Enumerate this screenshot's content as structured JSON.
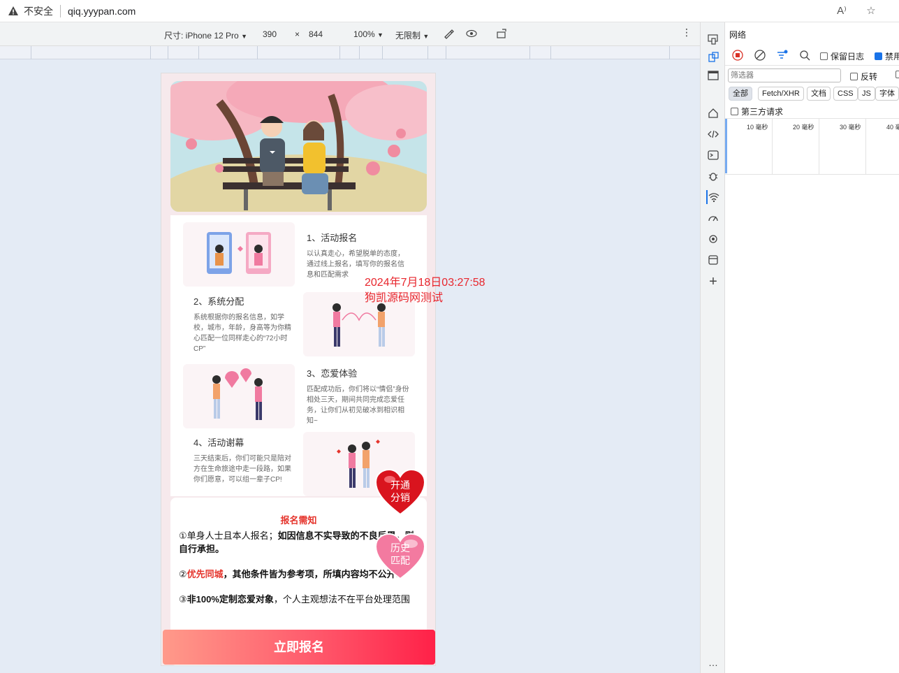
{
  "browser": {
    "security_label": "不安全",
    "url": "qiq.yyypan.com"
  },
  "device_toolbar": {
    "size_label": "尺寸: iPhone 12 Pro",
    "width": "390",
    "times": "×",
    "height": "844",
    "zoom": "100%",
    "throttle": "无限制"
  },
  "watermark": {
    "line1": "2024年7月18日03:27:58",
    "line2": "狗凯源码网测试"
  },
  "steps": [
    {
      "title": "1、活动报名",
      "desc": "以认真走心，希望脱单的态度，通过线上报名，填写你的报名信息和匹配需求"
    },
    {
      "title": "2、系统分配",
      "desc": "系统根据你的报名信息，如学校，城市，年龄，身高等为你精心匹配一位同样走心的“72小时CP”"
    },
    {
      "title": "3、恋爱体验",
      "desc": "匹配成功后，你们将以“情侣”身份相处三天，期间共同完成恋爱任务，让你们从初见破冰到相识相知~"
    },
    {
      "title": "4、活动谢幕",
      "desc": "三天结束后，你们可能只是陪对方在生命旅途中走一段路，如果你们愿意，可以组一辈子CP!"
    }
  ],
  "badges": {
    "distribution": "开通\n分销",
    "history": "历史\n匹配"
  },
  "notice": {
    "title": "报名需知",
    "line1_a": "①单身人士且本人报名；",
    "line1_b": "如因信息不实导致的不良后果，则自行承担。",
    "line2_a": "②",
    "line2_b": "优先同城",
    "line2_c": "，其他条件皆为参考项，所填内容均不公开!",
    "line3_a": "③",
    "line3_b": "非100%定制恋爱对象",
    "line3_c": "，个人主观想法不在平台处理范围"
  },
  "signup_button": "立即报名",
  "devtools": {
    "panel_title": "网络",
    "preserve_log": "保留日志",
    "disable_cache": "禁用",
    "filter_placeholder": "筛选器",
    "invert": "反转",
    "filters": [
      "全部",
      "Fetch/XHR",
      "文档",
      "CSS",
      "JS",
      "字体"
    ],
    "third_party": "第三方请求",
    "timeline": [
      "10 毫秒",
      "20 毫秒",
      "30 毫秒",
      "40 毫"
    ]
  },
  "colors": {
    "accent_red": "#e5342c",
    "button_gradient_end": "#ff2148",
    "devtools_blue": "#1a73e8"
  }
}
